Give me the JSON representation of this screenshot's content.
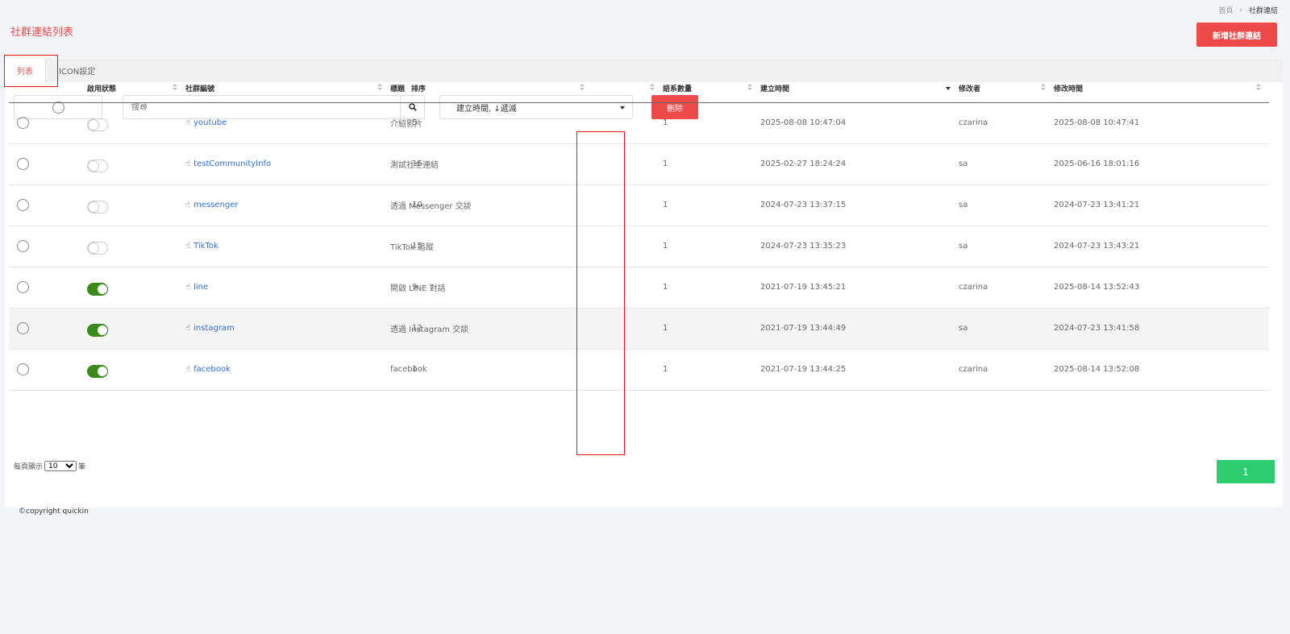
{
  "breadcrumb": {
    "home": "首頁",
    "separator": "›",
    "current": "社群連結"
  },
  "page_title": "社群連結列表",
  "add_button": "新增社群連結",
  "tabs": [
    {
      "label": "列表"
    },
    {
      "label": "ICON設定"
    }
  ],
  "search": {
    "placeholder": "搜尋"
  },
  "sort_select": {
    "value": "建立時間, ↓遞減"
  },
  "delete_button": "刪除",
  "table": {
    "headers": [
      "啟用狀態",
      "社群編號",
      "標題",
      "排序",
      "語系數量",
      "建立時間",
      "修改者",
      "修改時間"
    ],
    "rows": [
      {
        "enabled": false,
        "code": "youtube",
        "title": "介紹影片",
        "order": "5",
        "lang": "1",
        "created": "2025-08-08 10:47:04",
        "modifier": "czarina",
        "modified": "2025-08-08 10:47:41"
      },
      {
        "enabled": false,
        "code": "testCommunityInfo",
        "title": "測試社全連結",
        "order": "16",
        "lang": "1",
        "created": "2025-02-27 18:24:24",
        "modifier": "sa",
        "modified": "2025-06-16 18:01:16"
      },
      {
        "enabled": false,
        "code": "messenger",
        "title": "透過 Messenger 交談",
        "order": "10",
        "lang": "1",
        "created": "2024-07-23 13:37:15",
        "modifier": "sa",
        "modified": "2024-07-23 13:41:21"
      },
      {
        "enabled": false,
        "code": "TikTok",
        "title": "TikTok 追蹤",
        "order": "15",
        "lang": "1",
        "created": "2024-07-23 13:35:23",
        "modifier": "sa",
        "modified": "2024-07-23 13:43:21"
      },
      {
        "enabled": true,
        "code": "line",
        "title": "開啟 LINE 對話",
        "order": "9",
        "lang": "1",
        "created": "2021-07-19 13:45:21",
        "modifier": "czarina",
        "modified": "2025-08-14 13:52:43"
      },
      {
        "enabled": true,
        "code": "instagram",
        "title": "透過 Instagram 交談",
        "order": "12",
        "lang": "1",
        "created": "2021-07-19 13:44:49",
        "modifier": "sa",
        "modified": "2024-07-23 13:41:58"
      },
      {
        "enabled": true,
        "code": "facebook",
        "title": "facebook",
        "order": "1",
        "lang": "1",
        "created": "2021-07-19 13:44:25",
        "modifier": "czarina",
        "modified": "2025-08-14 13:52:08"
      }
    ]
  },
  "page_size": {
    "prefix": "每頁顯示",
    "value": "10",
    "suffix": "筆"
  },
  "pagination": {
    "current": "1"
  },
  "copyright": "©copyright quickin",
  "colors": {
    "accent_red": "#ef4a4a",
    "toggle_on": "#3a8a1a",
    "link": "#2a6fdb",
    "page_green": "#2ecc71"
  }
}
